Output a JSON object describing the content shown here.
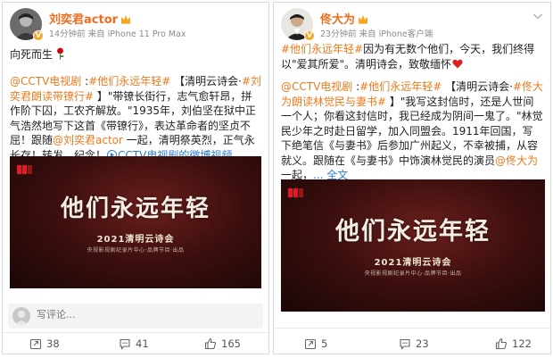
{
  "left_post": {
    "username": "刘奕君actor",
    "meta": "14分钟前  来自 iPhone 11 Pro Max",
    "line1": "向死而生",
    "body": {
      "p1": "@CCTV电视剧",
      "p2": " :",
      "p3": "#他们永远年轻#",
      "p4": " 【清明云诗会·",
      "p5": "#刘奕君朗读带镣行#",
      "p6": " 】\"带镣长街行，志气愈轩昂，拼作阶下囚，工农齐解放。\"1935年，刘伯坚在狱中正气浩然地写下这首《带镣行》，表达革命者的坚贞不屈！跟随",
      "p7": "@刘奕君actor",
      "p8": " 一起，清明祭英烈，正气永长存！转发，纪念！",
      "p9": "CCTV电视剧的微博视频"
    },
    "video": {
      "title": "他们永远年轻",
      "subtitle": "2021清明云诗会",
      "small": "央视影视剧纪录片中心·品牌节目·出品"
    },
    "comment_placeholder": "写评论...",
    "actions": {
      "repost": "38",
      "comment": "41",
      "like": "165"
    }
  },
  "right_post": {
    "username": "佟大为",
    "meta": "23分钟前  来自 iPhone客户端",
    "body": {
      "p1": "#他们永远年轻#",
      "p2": "因为有无数个他们，今天，我们终得以\"爱其所爱\"。清明诗会，致敬缅怀",
      "p3": "@CCTV电视剧",
      "p4": " :",
      "p5": "#他们永远年轻#",
      "p6": " 【清明云诗会·",
      "p7": "#佟大为朗读林觉民与妻书#",
      "p8": " 】\"我写这封信时，还是人世间一个人；你看这封信时，我已经成为阴间一鬼了。\"林觉民少年之时赴日留学，加入同盟会。1911年回国，写下绝笔信《与妻书》后参加广州起义，不幸被捕，从容就义。跟随在《与妻书》中饰演林觉民的演员",
      "p9": "@佟大为",
      "p10": " 一起，",
      "p11": "... 全文"
    },
    "video": {
      "title": "他们永远年轻",
      "subtitle": "2021清明云诗会",
      "small": "央视影视剧纪录片中心·品牌节目·出品"
    },
    "actions": {
      "repost": "5",
      "comment": "23",
      "like": "122"
    }
  },
  "colors": {
    "username": "#f26b1d",
    "topic": "#ec7a1c",
    "link": "#2a7ed0",
    "video_bg": "#3c0f0e",
    "meta": "#8a8a8a"
  },
  "icons": [
    "verified-crown-icon",
    "chevron-down-icon",
    "rose-icon",
    "heart-icon",
    "play-icon",
    "repost-icon",
    "comment-icon",
    "like-icon",
    "cctv-logo-icon"
  ]
}
